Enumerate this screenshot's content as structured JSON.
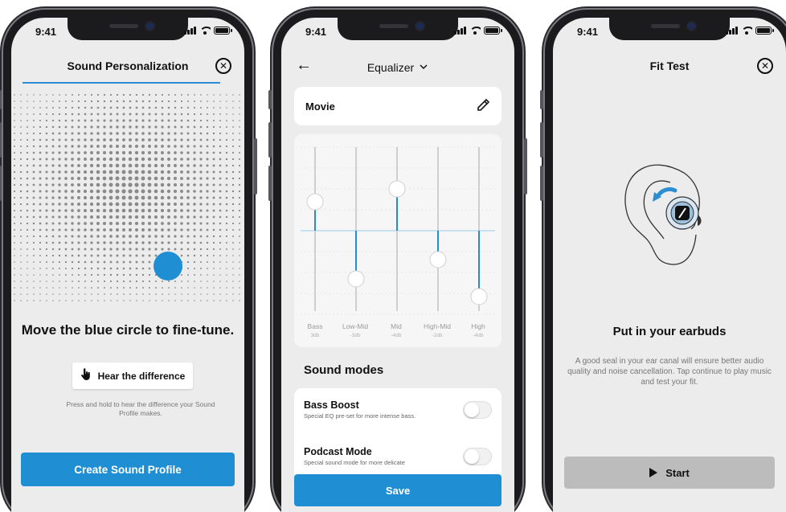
{
  "status": {
    "time": "9:41"
  },
  "personalization": {
    "title": "Sound Personalization",
    "close_icon": "close-circle-icon",
    "heading": "Move the blue circle to fine-tune.",
    "hear_button": "Hear the difference",
    "hint": "Press and hold to hear the difference your Sound Profile makes.",
    "create_button": "Create Sound Profile",
    "accent": "#1f8ed3"
  },
  "equalizer": {
    "title": "Equalizer",
    "preset_name": "Movie",
    "bands": [
      {
        "name": "Bass",
        "value": "3db"
      },
      {
        "name": "Low-Mid",
        "value": "-3db"
      },
      {
        "name": "Mid",
        "value": "-4db"
      },
      {
        "name": "High-Mid",
        "value": "-2db"
      },
      {
        "name": "High",
        "value": "-4db"
      }
    ],
    "modes_heading": "Sound modes",
    "modes": [
      {
        "title": "Bass Boost",
        "desc": "Special EQ pre-set for more intense bass.",
        "on": false
      },
      {
        "title": "Podcast Mode",
        "desc": "Special sound mode for more delicate",
        "on": false
      }
    ],
    "save_button": "Save"
  },
  "fit_test": {
    "title": "Fit Test",
    "heading": "Put in your earbuds",
    "description": "A good seal in your ear canal will ensure better audio quality and noise cancellation. Tap continue to play music and test your fit.",
    "start_button": "Start"
  }
}
